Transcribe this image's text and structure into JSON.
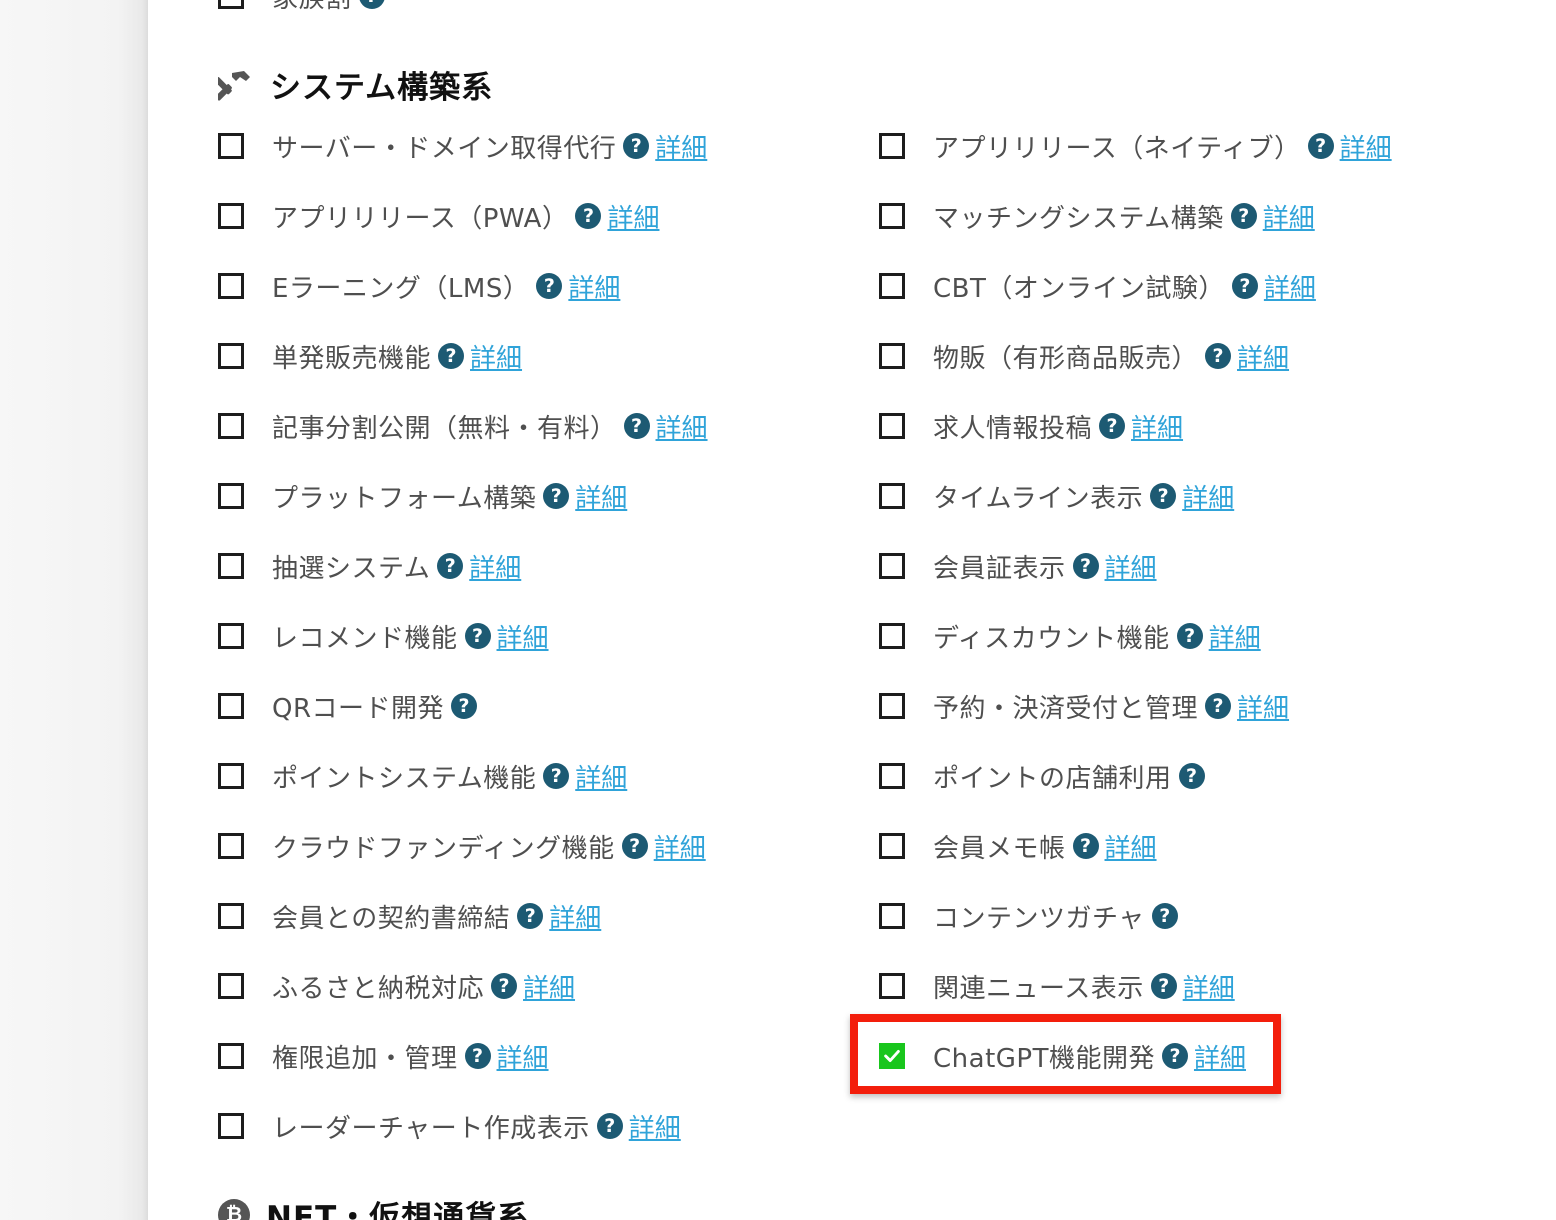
{
  "top_partial": {
    "label": "家族割"
  },
  "sections": {
    "system": {
      "title": "システム構築系",
      "icon": "hammer-icon"
    },
    "nft": {
      "title": "NFT・仮想通貨系",
      "icon": "bitcoin-icon",
      "icon_glyph": "₿"
    }
  },
  "help_glyph": "?",
  "detail_label": "詳細",
  "left_options": [
    {
      "label": "サーバー・ドメイン取得代行",
      "has_detail": true,
      "checked": false
    },
    {
      "label": "アプリリリース（PWA）",
      "has_detail": true,
      "checked": false
    },
    {
      "label": "Eラーニング（LMS）",
      "has_detail": true,
      "checked": false
    },
    {
      "label": "単発販売機能",
      "has_detail": true,
      "checked": false
    },
    {
      "label": "記事分割公開（無料・有料）",
      "has_detail": true,
      "checked": false
    },
    {
      "label": "プラットフォーム構築",
      "has_detail": true,
      "checked": false
    },
    {
      "label": "抽選システム",
      "has_detail": true,
      "checked": false
    },
    {
      "label": "レコメンド機能",
      "has_detail": true,
      "checked": false
    },
    {
      "label": "QRコード開発",
      "has_detail": false,
      "checked": false
    },
    {
      "label": "ポイントシステム機能",
      "has_detail": true,
      "checked": false
    },
    {
      "label": "クラウドファンディング機能",
      "has_detail": true,
      "checked": false
    },
    {
      "label": "会員との契約書締結",
      "has_detail": true,
      "checked": false
    },
    {
      "label": "ふるさと納税対応",
      "has_detail": true,
      "checked": false
    },
    {
      "label": "権限追加・管理",
      "has_detail": true,
      "checked": false
    },
    {
      "label": "レーダーチャート作成表示",
      "has_detail": true,
      "checked": false
    }
  ],
  "right_options": [
    {
      "label": "アプリリリース（ネイティブ）",
      "has_detail": true,
      "checked": false
    },
    {
      "label": "マッチングシステム構築",
      "has_detail": true,
      "checked": false
    },
    {
      "label": "CBT（オンライン試験）",
      "has_detail": true,
      "checked": false
    },
    {
      "label": "物販（有形商品販売）",
      "has_detail": true,
      "checked": false
    },
    {
      "label": "求人情報投稿",
      "has_detail": true,
      "checked": false
    },
    {
      "label": "タイムライン表示",
      "has_detail": true,
      "checked": false
    },
    {
      "label": "会員証表示",
      "has_detail": true,
      "checked": false
    },
    {
      "label": "ディスカウント機能",
      "has_detail": true,
      "checked": false
    },
    {
      "label": "予約・決済受付と管理",
      "has_detail": true,
      "checked": false
    },
    {
      "label": "ポイントの店舗利用",
      "has_detail": false,
      "checked": false
    },
    {
      "label": "会員メモ帳",
      "has_detail": true,
      "checked": false
    },
    {
      "label": "コンテンツガチャ",
      "has_detail": false,
      "checked": false
    },
    {
      "label": "関連ニュース表示",
      "has_detail": true,
      "checked": false
    },
    {
      "label": "ChatGPT機能開発",
      "has_detail": true,
      "checked": true,
      "highlighted": true
    }
  ],
  "colors": {
    "checked": "#19c61d",
    "help_icon": "#1d5a73",
    "link": "#2fa3d9",
    "highlight": "#f31e0c"
  }
}
